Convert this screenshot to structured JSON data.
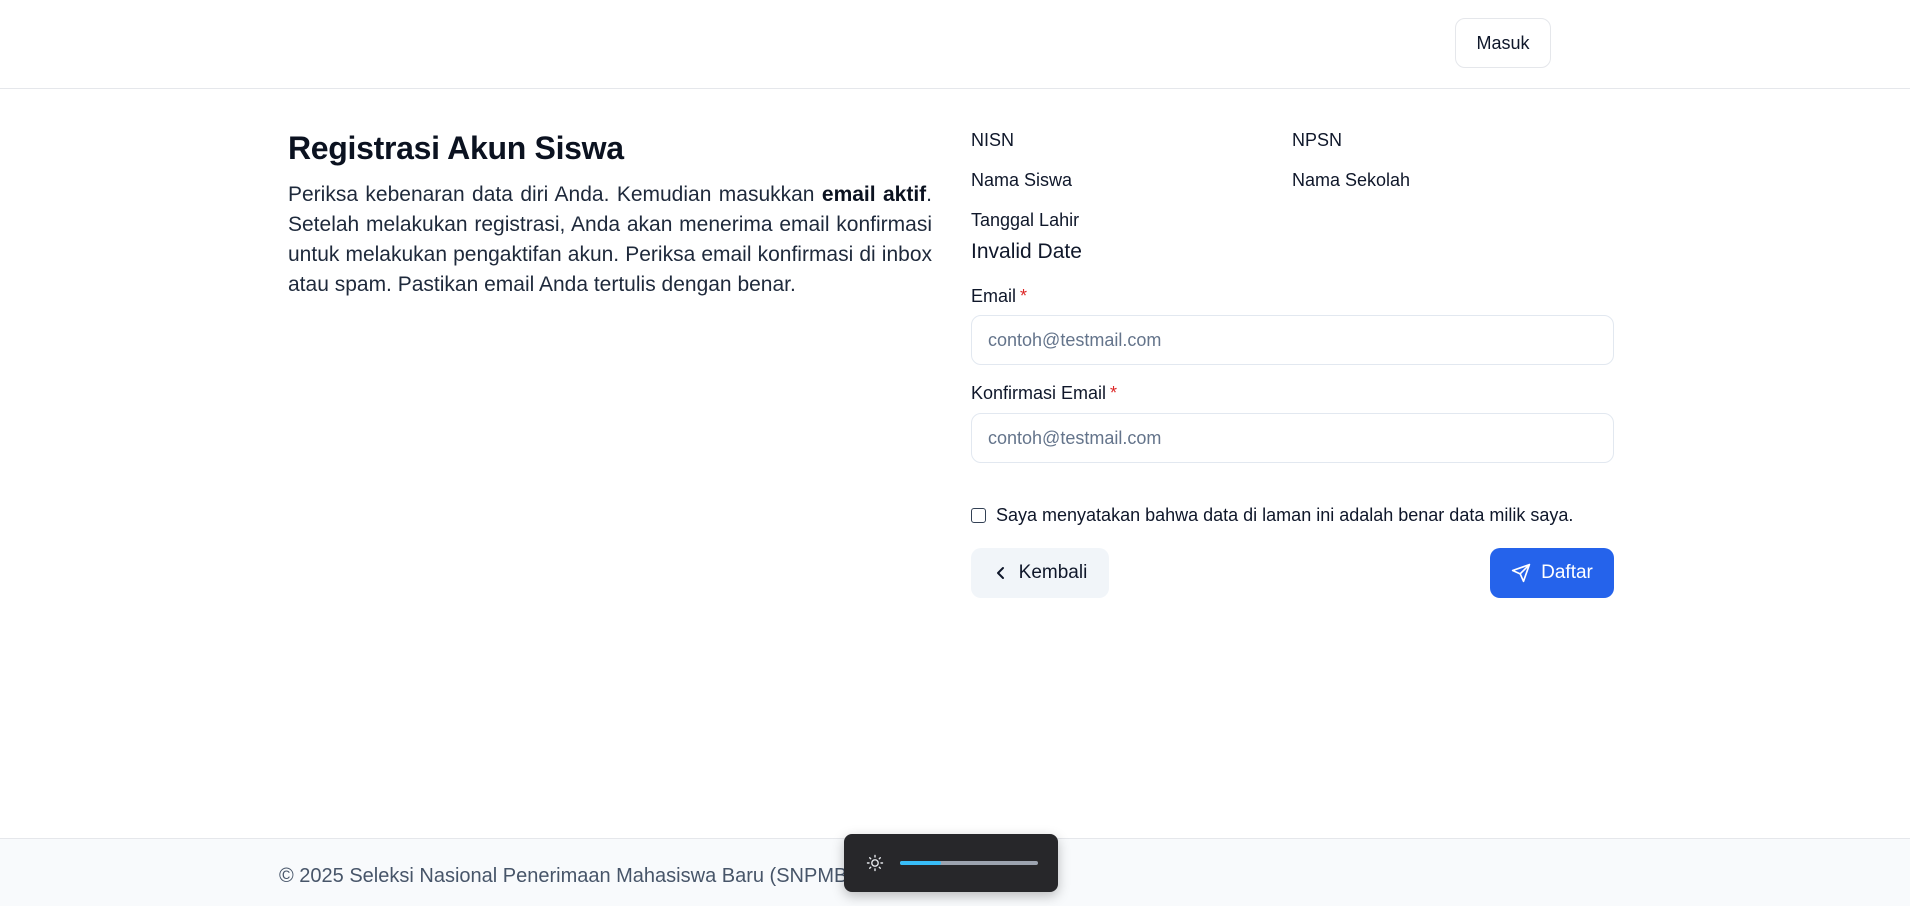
{
  "header": {
    "login_label": "Masuk"
  },
  "intro": {
    "title": "Registrasi Akun Siswa",
    "desc_before": "Periksa kebenaran data diri Anda. Kemudian masukkan ",
    "desc_bold": "email aktif",
    "desc_after": ". Setelah melakukan registrasi, Anda akan menerima email konfirmasi untuk melakukan pengaktifan akun. Periksa email konfirmasi di inbox atau spam. Pastikan email Anda tertulis dengan benar."
  },
  "student_info": {
    "nisn_label": "NISN",
    "npsn_label": "NPSN",
    "name_label": "Nama Siswa",
    "school_label": "Nama Sekolah",
    "dob_label": "Tanggal Lahir",
    "dob_value": "Invalid Date"
  },
  "form": {
    "email_label": "Email",
    "email_required": "*",
    "email_placeholder": "contoh@testmail.com",
    "email_value": "",
    "confirm_label": "Konfirmasi Email",
    "confirm_required": "*",
    "confirm_placeholder": "contoh@testmail.com",
    "confirm_value": "",
    "agree_text": "Saya menyatakan bahwa data di laman ini adalah benar data milik saya.",
    "agree_checked": false,
    "back_label": "Kembali",
    "submit_label": "Daftar"
  },
  "footer": {
    "text": "© 2025 Seleksi Nasional Penerimaan Mahasiswa Baru (SNPMB)"
  },
  "theme_control": {
    "brightness_level": 0.3,
    "icon": "sun-icon"
  },
  "colors": {
    "primary": "#2563eb",
    "required": "#dc2626",
    "slider_fill": "#38bdf8"
  }
}
